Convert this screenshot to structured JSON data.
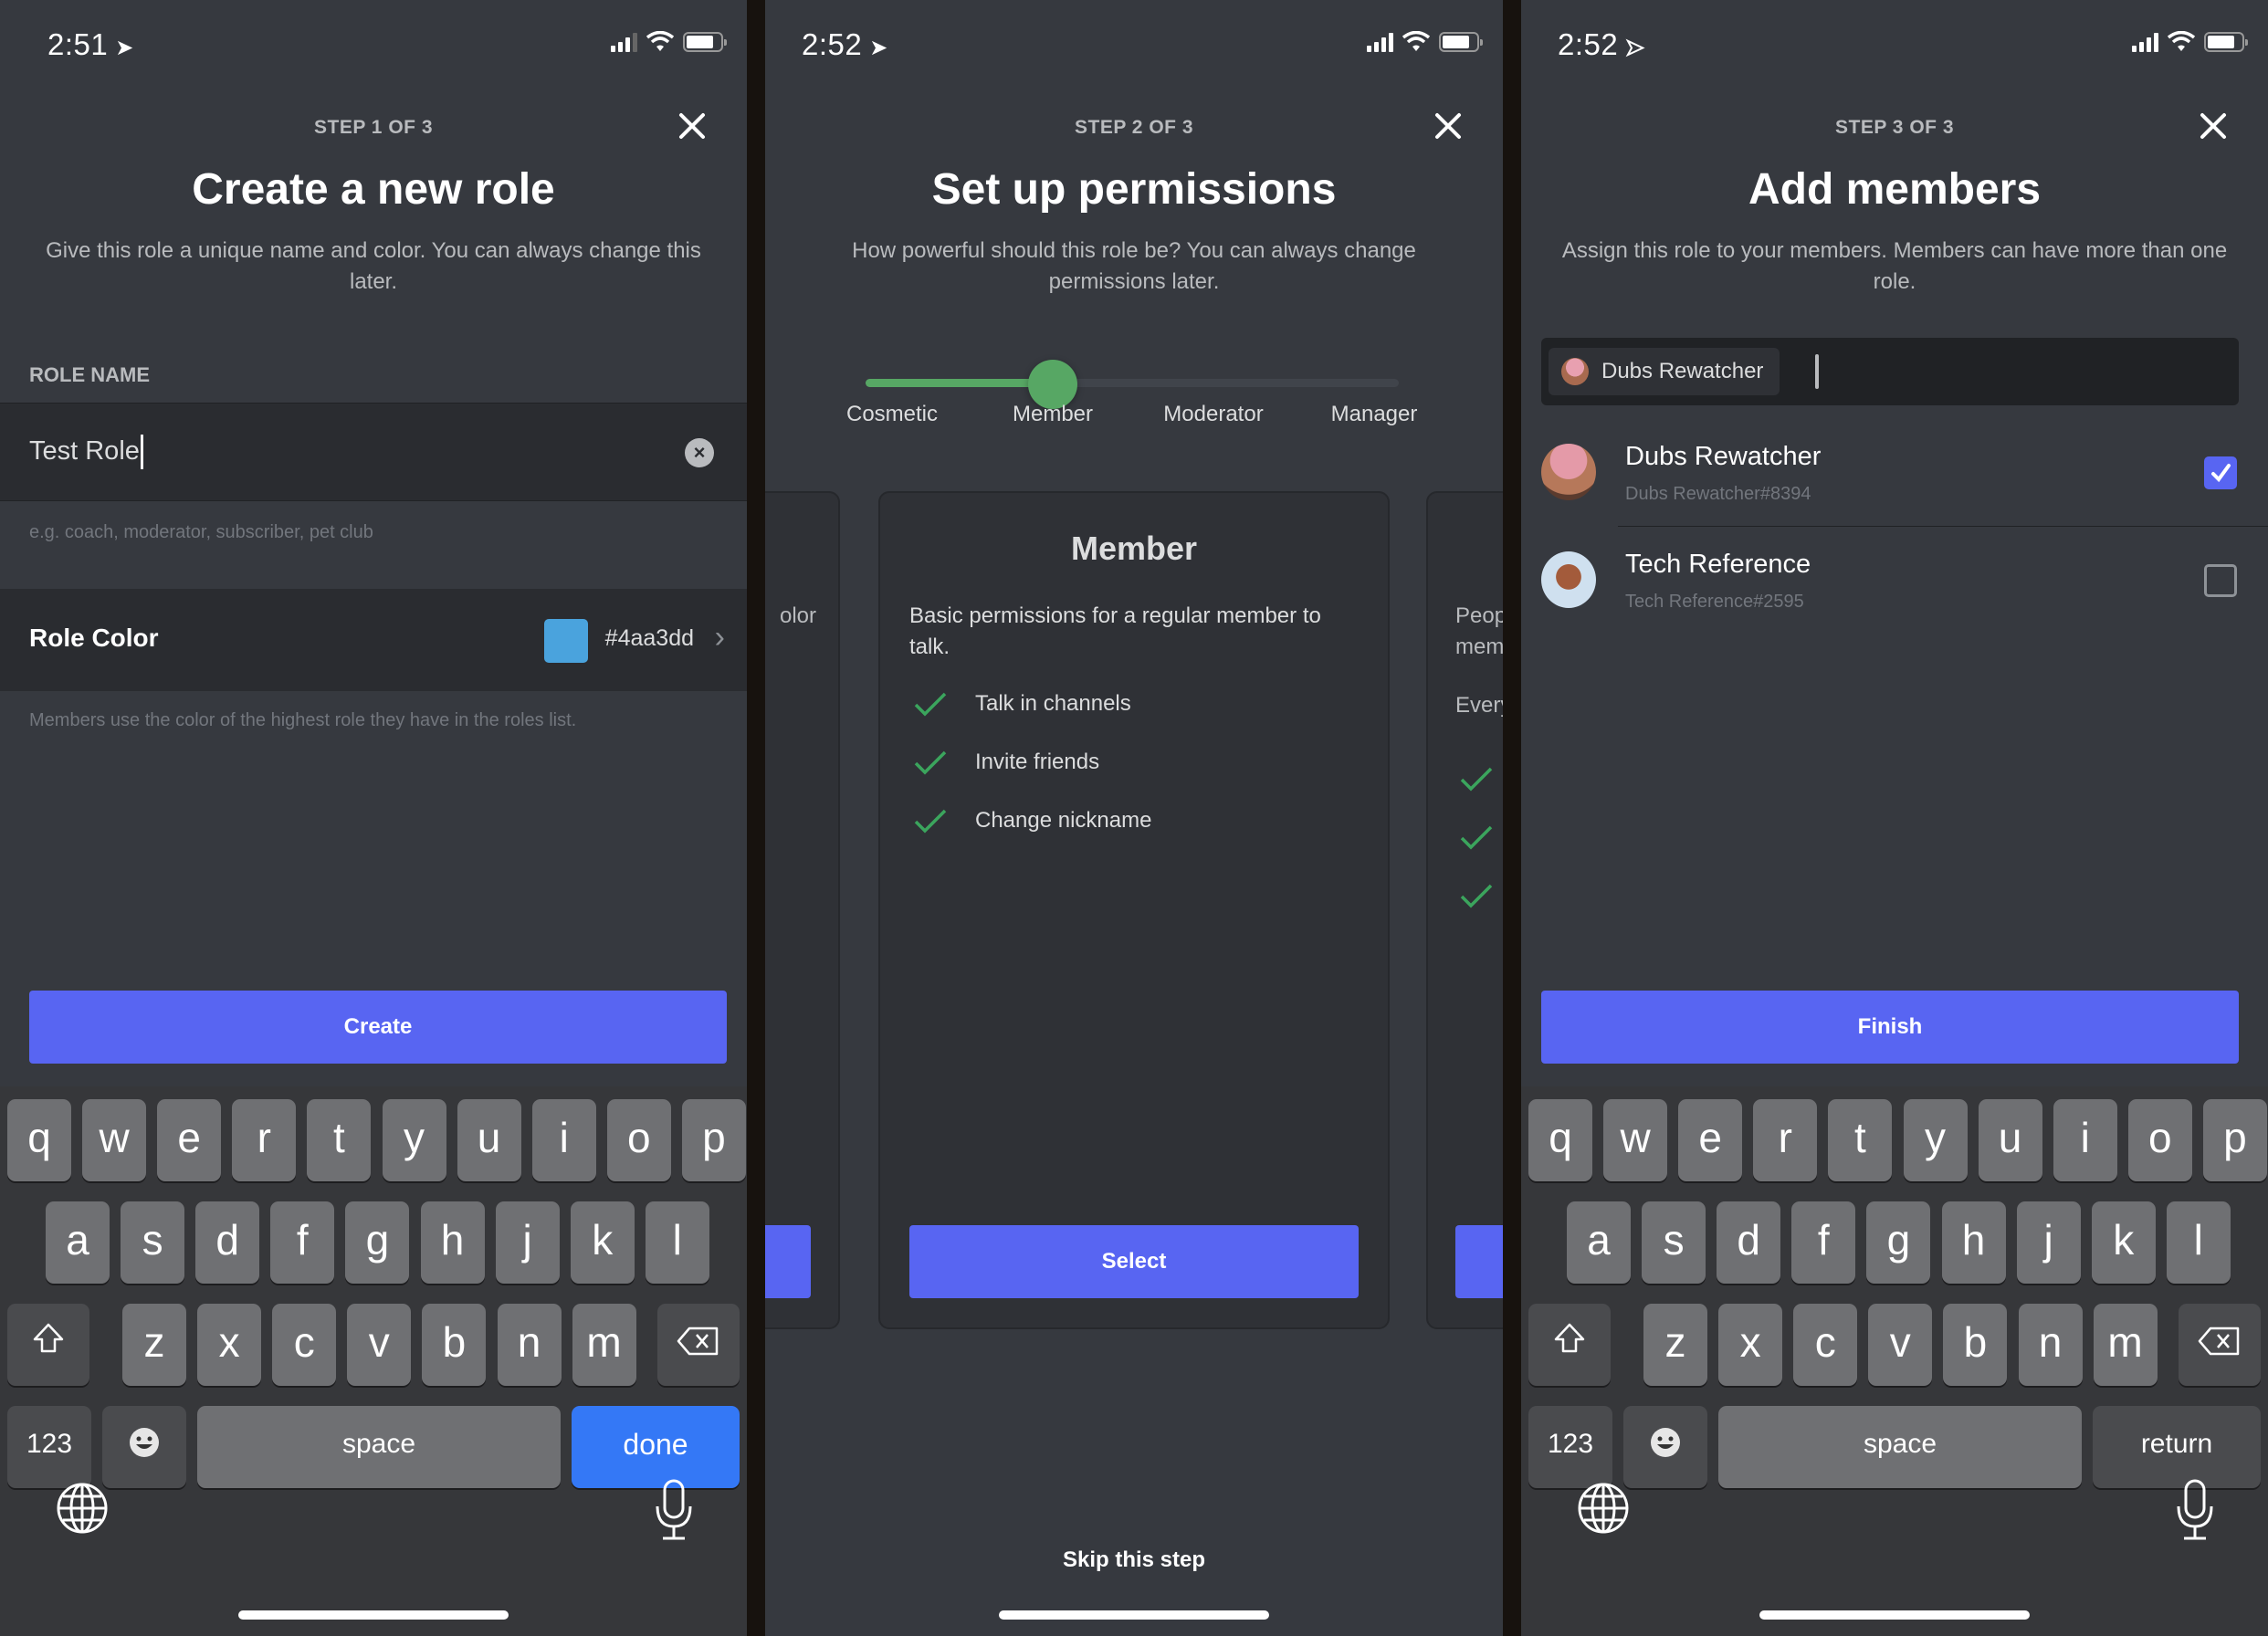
{
  "panels": {
    "step1": {
      "status": {
        "time": "2:51"
      },
      "step_label": "STEP 1 OF 3",
      "title": "Create a new role",
      "subtitle": "Give this role a unique name and color. You can always change this later.",
      "role_name_label": "ROLE NAME",
      "role_name_value": "Test Role",
      "role_name_placeholder": "e.g. coach, moderator, subscriber, pet club",
      "role_color_label": "Role Color",
      "role_color_hex": "#4aa3dd",
      "role_color_note": "Members use the color of the highest role they have in the roles list.",
      "create_label": "Create",
      "keyboard_action": "done"
    },
    "step2": {
      "status": {
        "time": "2:52"
      },
      "step_label": "STEP 2 OF 3",
      "title": "Set up permissions",
      "subtitle": "How powerful should this role be? You can always change permissions later.",
      "slider": {
        "levels": [
          "Cosmetic",
          "Member",
          "Moderator",
          "Manager"
        ],
        "selected_index": 1
      },
      "card": {
        "title": "Member",
        "description": "Basic permissions for a regular member to talk.",
        "permissions": [
          "Talk in channels",
          "Invite friends",
          "Change nickname"
        ],
        "select_label": "Select"
      },
      "prev_card_fragment": "olor",
      "next_card_fragment": [
        "Peop",
        "mem",
        "Every"
      ],
      "skip_label": "Skip this step"
    },
    "step3": {
      "status": {
        "time": "2:52"
      },
      "step_label": "STEP 3 OF 3",
      "title": "Add members",
      "subtitle": "Assign this role to your members. Members can have more than one role.",
      "chip_label": "Dubs Rewatcher",
      "members": [
        {
          "name": "Dubs Rewatcher",
          "tag": "Dubs Rewatcher#8394",
          "checked": true
        },
        {
          "name": "Tech Reference",
          "tag": "Tech Reference#2595",
          "checked": false
        }
      ],
      "finish_label": "Finish",
      "keyboard_action": "return"
    }
  },
  "keyboard": {
    "row1": [
      "q",
      "w",
      "e",
      "r",
      "t",
      "y",
      "u",
      "i",
      "o",
      "p"
    ],
    "row2": [
      "a",
      "s",
      "d",
      "f",
      "g",
      "h",
      "j",
      "k",
      "l"
    ],
    "row3": [
      "z",
      "x",
      "c",
      "v",
      "b",
      "n",
      "m"
    ],
    "numbers_label": "123",
    "space_label": "space"
  },
  "colors": {
    "accent": "#5865f2",
    "slider_green": "#57a764",
    "keyboard_done": "#3478f6",
    "role_color": "#4aa3dd"
  }
}
